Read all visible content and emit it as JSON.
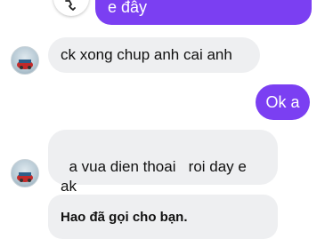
{
  "messages": {
    "out_top": "e đây",
    "in_1": "ck xong chup anh cai anh",
    "out_ok": "Ok a",
    "in_2": "a vua dien thoai   roi day e\nak",
    "in_3": "Hao đã gọi cho bạn."
  },
  "icons": {
    "top_button": "phone-icon",
    "avatar": "contact-avatar"
  },
  "colors": {
    "outgoing_bubble": "#7b3ff2",
    "incoming_bubble": "#eeeff1"
  }
}
